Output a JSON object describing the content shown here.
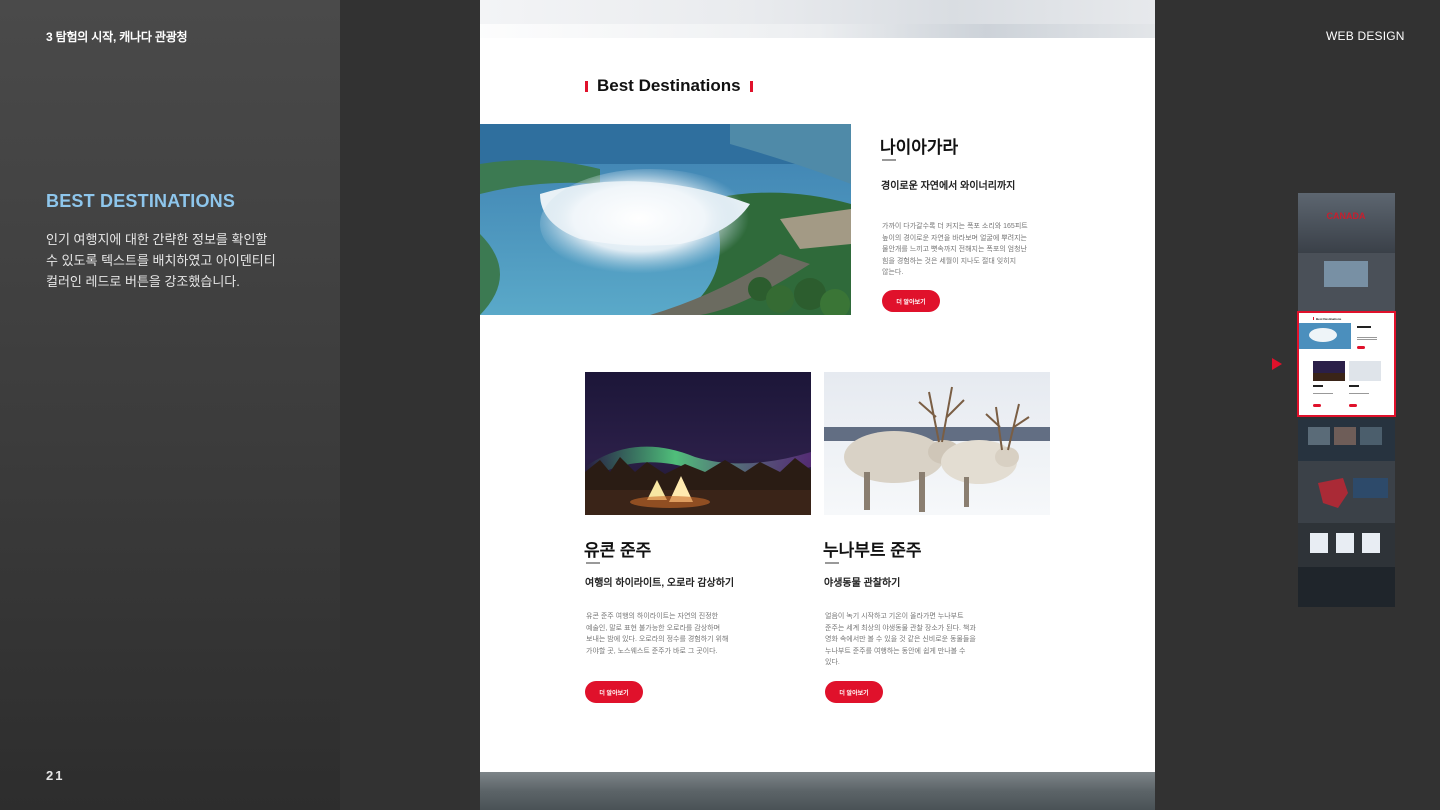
{
  "left": {
    "project_title": "3 탐험의 시작, 캐나다 관광청",
    "section_heading": "BEST DESTINATIONS",
    "section_desc": "인기 여행지에 대한 간략한 정보를 확인할\n수 있도록 텍스트를 배치하였고 아이덴티티\n컬러인 레드로 버튼을 강조했습니다.",
    "page_number": "21"
  },
  "right": {
    "label": "WEB DESIGN",
    "thumbnail_title": "CANADA",
    "thumbnail_section": "Best Destinations"
  },
  "page": {
    "section_title": "Best Destinations",
    "destinations": [
      {
        "title": "나이아가라",
        "subtitle": "경이로운 자연에서 와이너리까지",
        "description": "가까이 다가갈수록 더 커지는 폭포 소리와 165피트\n높이의 경이로운 자연을 바라보며 얼굴에 뿌려지는\n물안개를 느끼고 뼛속까지 전해지는 폭포의 엄청난\n힘을 경험하는 것은 세월이 지나도 절대 잊히지\n않는다.",
        "button": "더 알아보기"
      },
      {
        "title": "유콘 준주",
        "subtitle": "여행의 하이라이트, 오로라 감상하기",
        "description": "유콘 준주 여행의 하이라이트는 자연의 진정한\n예술인, 말로 표현 불가능한 오로라를 감상하며\n보내는 밤에 있다. 오로라의 정수를 경험하기 위해\n가야할 곳, 노스웨스트 준주가 바로 그 곳이다.",
        "button": "더 알아보기"
      },
      {
        "title": "누나부트 준주",
        "subtitle": "야생동물 관찰하기",
        "description": "얼음이 녹기 시작하고 기온이 올라가면 누나부트\n준주는 세계 최상의 야생동물 관찰 장소가 된다. 책과\n영화 속에서만 볼 수 있을 것 같은 신비로운 동물들을\n누나부트 준주를 여행하는 동안에 쉽게 만나볼 수\n있다.",
        "button": "더 알아보기"
      }
    ]
  },
  "colors": {
    "accent_red": "#e0112b",
    "heading_blue": "#8ec6ec",
    "panel_dark": "#323232"
  }
}
